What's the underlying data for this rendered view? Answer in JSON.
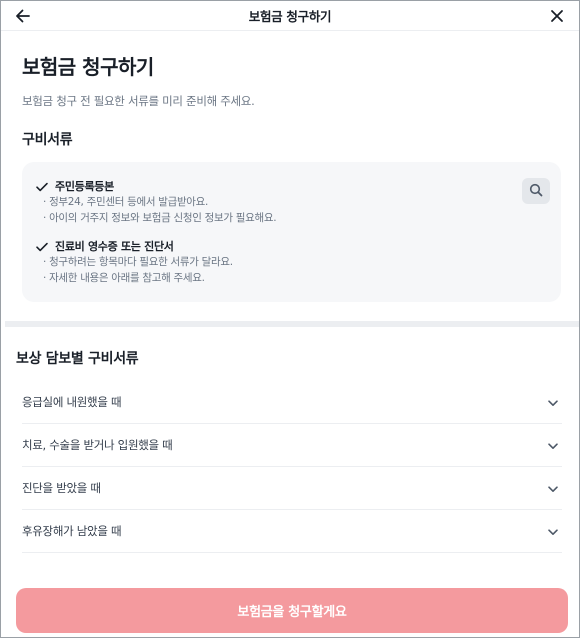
{
  "header": {
    "title": "보험금 청구하기",
    "back_icon": "arrow-left-icon",
    "close_icon": "close-icon"
  },
  "main": {
    "title": "보험금 청구하기",
    "subtitle": "보험금 청구 전 필요한 서류를 미리 준비해 주세요.",
    "docs_heading": "구비서류",
    "docs": [
      {
        "title": "주민등록등본",
        "notes": [
          "· 정부24, 주민센터 등에서 발급받아요.",
          "· 아이의 거주지 정보와 보험금 신청인 정보가 필요해요."
        ]
      },
      {
        "title": "진료비 영수증 또는 진단서",
        "notes": [
          "· 청구하려는 항목마다 필요한 서류가 달라요.",
          "· 자세한 내용은 아래를 참고해 주세요."
        ]
      }
    ],
    "coverage_heading": "보상 담보별 구비서류",
    "coverage_items": [
      {
        "label": "응급실에 내원했을 때"
      },
      {
        "label": "치료, 수술을 받거나 입원했을 때"
      },
      {
        "label": "진단을 받았을 때"
      },
      {
        "label": "후유장해가 남았을 때"
      }
    ]
  },
  "cta": {
    "label": "보험금을 청구할게요",
    "color": "#f49a9e"
  }
}
